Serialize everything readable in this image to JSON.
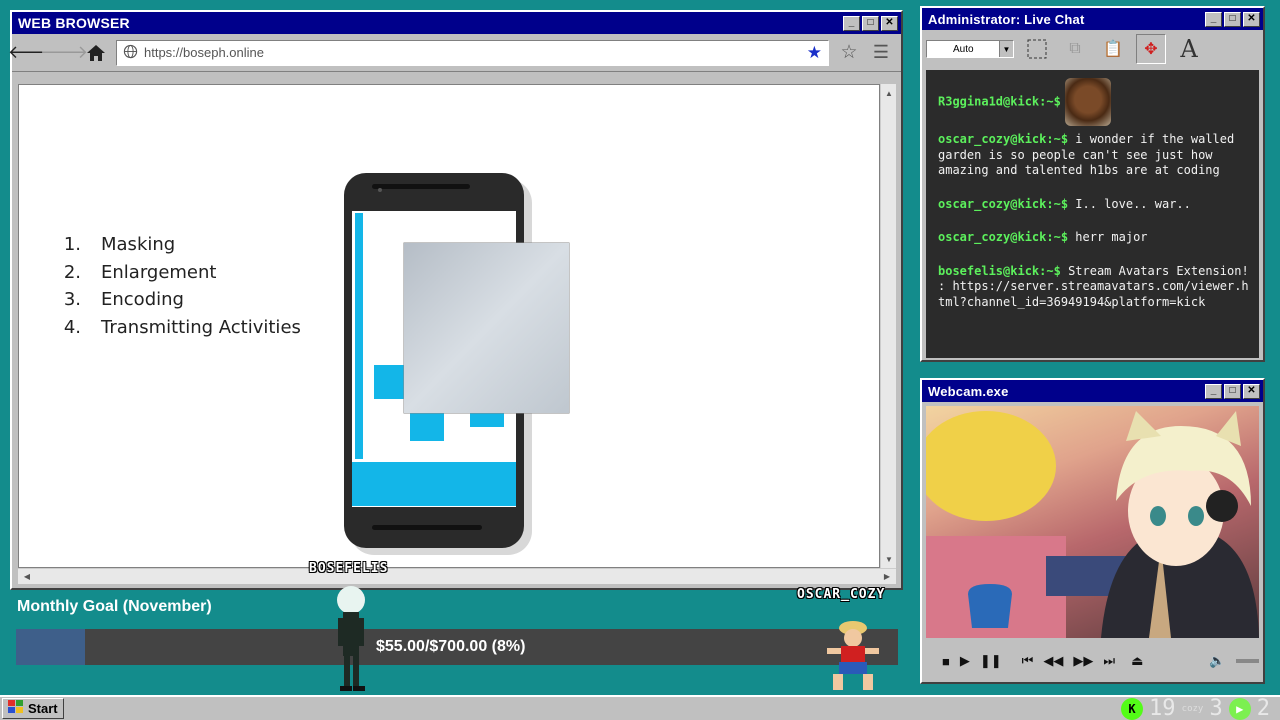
{
  "browser": {
    "title": "WEB BROWSER",
    "url": "https://boseph.online"
  },
  "slide": {
    "items": [
      {
        "num": "1.",
        "label": "Masking"
      },
      {
        "num": "2.",
        "label": "Enlargement"
      },
      {
        "num": "3.",
        "label": "Encoding"
      },
      {
        "num": "4.",
        "label": "Transmitting Activities"
      }
    ]
  },
  "chat": {
    "title": "Administrator: Live Chat",
    "font_select": "Auto",
    "messages": [
      {
        "user": "R3ggina1d@kick:~$",
        "text": ""
      },
      {
        "user": "oscar_cozy@kick:~$",
        "text": "i wonder if the walled garden is so people can't see just how amazing and talented h1bs are at coding"
      },
      {
        "user": "oscar_cozy@kick:~$",
        "text": "I.. love.. war.."
      },
      {
        "user": "oscar_cozy@kick:~$",
        "text": "herr major"
      },
      {
        "user": "bosefelis@kick:~$",
        "text": "Stream Avatars Extension! : https://server.streamavatars.com/viewer.html?channel_id=36949194&platform=kick"
      }
    ]
  },
  "webcam": {
    "title": "Webcam.exe"
  },
  "goal": {
    "title": "Monthly Goal (November)",
    "progress_text": "$55.00/$700.00 (8%)",
    "progress_fraction": 0.0786
  },
  "avatars": {
    "left_name": "BOSEFELIS",
    "right_name": "OSCAR_COZY"
  },
  "taskbar": {
    "start_label": "Start",
    "kick_count": "19",
    "cozy_count": "3",
    "green_count": "2",
    "cozy_label": "cozy"
  },
  "colors": {
    "desktop": "#138c8c",
    "titlebar": "#00008b",
    "chat_username": "#5cf05c",
    "phone_accent": "#13b6e8"
  }
}
